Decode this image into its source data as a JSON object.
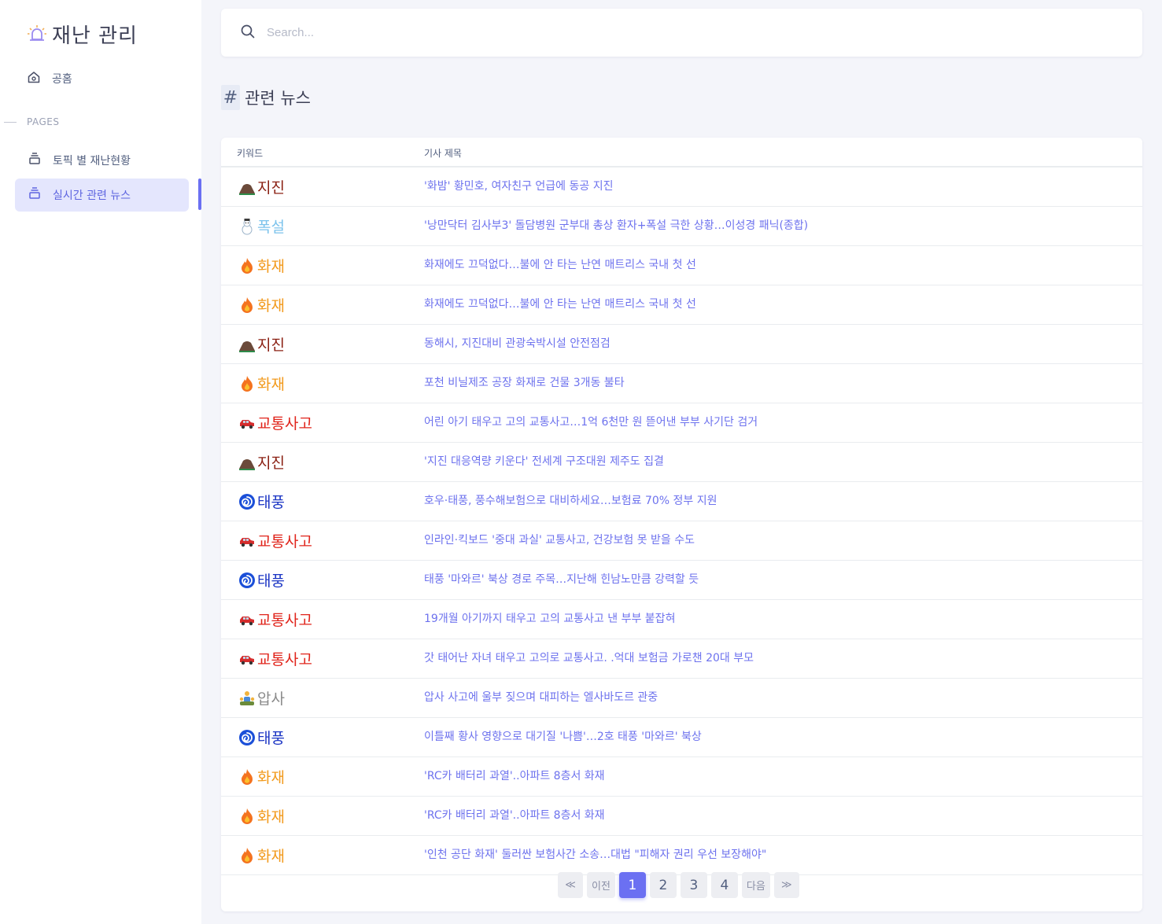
{
  "app": {
    "title": "재난 관리"
  },
  "sidebar": {
    "home_label": "공홈",
    "section_label": "PAGES",
    "items": [
      {
        "label": "토픽 별 재난현황"
      },
      {
        "label": "실시간 관련 뉴스"
      }
    ]
  },
  "search": {
    "placeholder": "Search..."
  },
  "section": {
    "hash": "#",
    "title": "관련 뉴스"
  },
  "table": {
    "headers": {
      "keyword": "키워드",
      "title": "기사 제목"
    },
    "rows": [
      {
        "keyword": "지진",
        "type": "earthquake",
        "color": "#8a1f12",
        "title": "'화밤' 황민호, 여자친구 언급에 동공 지진"
      },
      {
        "keyword": "폭설",
        "type": "snow",
        "color": "#7cc3ec",
        "title": "'낭만닥터 김사부3' 돌담병원 군부대 총상 환자+폭설 극한 상황…이성경 패닉(종합)"
      },
      {
        "keyword": "화재",
        "type": "fire",
        "color": "#f29a1c",
        "title": "화재에도 끄덕없다…불에 안 타는 난연 매트리스 국내 첫 선"
      },
      {
        "keyword": "화재",
        "type": "fire",
        "color": "#f29a1c",
        "title": "화재에도 끄덕없다…불에 안 타는 난연 매트리스 국내 첫 선"
      },
      {
        "keyword": "지진",
        "type": "earthquake",
        "color": "#8a1f12",
        "title": "동해시, 지진대비 관광숙박시설 안전점검"
      },
      {
        "keyword": "화재",
        "type": "fire",
        "color": "#f29a1c",
        "title": "포천 비닐제조 공장 화재로 건물 3개동 불타"
      },
      {
        "keyword": "교통사고",
        "type": "car",
        "color": "#e0241b",
        "title": "어린 아기 태우고 고의 교통사고…1억 6천만 원 뜯어낸 부부 사기단 검거"
      },
      {
        "keyword": "지진",
        "type": "earthquake",
        "color": "#8a1f12",
        "title": "'지진 대응역량 키운다' 전세계 구조대원 제주도 집결"
      },
      {
        "keyword": "태풍",
        "type": "typhoon",
        "color": "#1b35c4",
        "title": "호우·태풍, 풍수해보험으로 대비하세요…보험료 70% 정부 지원"
      },
      {
        "keyword": "교통사고",
        "type": "car",
        "color": "#e0241b",
        "title": "인라인·킥보드 '중대 과실' 교통사고, 건강보험 못 받을 수도"
      },
      {
        "keyword": "태풍",
        "type": "typhoon",
        "color": "#1b35c4",
        "title": "태풍 '마와르' 북상 경로 주목…지난해 힌남노만큼 강력할 듯"
      },
      {
        "keyword": "교통사고",
        "type": "car",
        "color": "#e0241b",
        "title": "19개월 아기까지 태우고 고의 교통사고 낸 부부 붙잡혀"
      },
      {
        "keyword": "교통사고",
        "type": "car",
        "color": "#e0241b",
        "title": "갓 태어난 자녀 태우고 고의로 교통사고. .억대 보험금 가로챈 20대 부모"
      },
      {
        "keyword": "압사",
        "type": "crush",
        "color": "#8a8a8a",
        "title": "압사 사고에 울부 짖으며 대피하는 엘사바도르 관중"
      },
      {
        "keyword": "태풍",
        "type": "typhoon",
        "color": "#1b35c4",
        "title": "이틀째 황사 영향으로 대기질 '나쁨'…2호 태풍 '마와르' 북상"
      },
      {
        "keyword": "화재",
        "type": "fire",
        "color": "#f29a1c",
        "title": "'RC카 배터리 과열'..아파트 8층서 화재"
      },
      {
        "keyword": "화재",
        "type": "fire",
        "color": "#f29a1c",
        "title": "'RC카 배터리 과열'..아파트 8층서 화재"
      },
      {
        "keyword": "화재",
        "type": "fire",
        "color": "#f29a1c",
        "title": "'인천 공단 화재' 둘러싼 보험사간 소송…대법 \"피해자 권리 우선 보장해야\""
      }
    ]
  },
  "pagination": {
    "first": "≪",
    "prev": "이전",
    "pages": [
      "1",
      "2",
      "3",
      "4"
    ],
    "current": "1",
    "next": "다음",
    "last": "≫"
  },
  "colors": {
    "accent": "#6b70f2",
    "link": "#6d72ee"
  }
}
